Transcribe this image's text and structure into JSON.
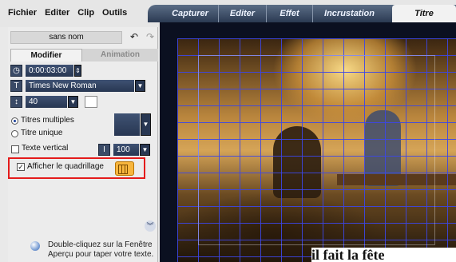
{
  "menu": [
    "Fichier",
    "Editer",
    "Clip",
    "Outils"
  ],
  "tabs": [
    "Capturer",
    "Editer",
    "Effet",
    "Incrustation",
    "Titre"
  ],
  "active_tab": "Titre",
  "left_panel": {
    "file_name": "sans nom",
    "subtabs": {
      "active": "Modifier",
      "inactive": "Animation"
    },
    "timecode": "0:00:03:00",
    "font": "Times New Roman",
    "font_size": "40",
    "options": {
      "multi": "Titres multiples",
      "single": "Titre unique",
      "vertical": "Texte vertical",
      "vertical_value": "100",
      "grid": "Afficher le quadrillage",
      "grid_checkbox_mark": "✓"
    },
    "hint": "Double-cliquez sur la Fenêtre Aperçu pour taper votre texte."
  },
  "preview": {
    "title_text": "il fait la fête"
  },
  "icons": {
    "undo": "undo-icon",
    "redo": "redo-icon",
    "timecode": "clock-icon",
    "font": "font-T-icon",
    "size": "text-size-icon",
    "vertical": "vertical-text-icon",
    "grid": "grid-settings-icon",
    "expand": "chevron-down-double-icon",
    "hint": "info-bulb-icon"
  },
  "colors": {
    "highlight": "#e41b1b",
    "grid_lines": "#3c46e6",
    "tab_bar": "#2b3a52"
  }
}
